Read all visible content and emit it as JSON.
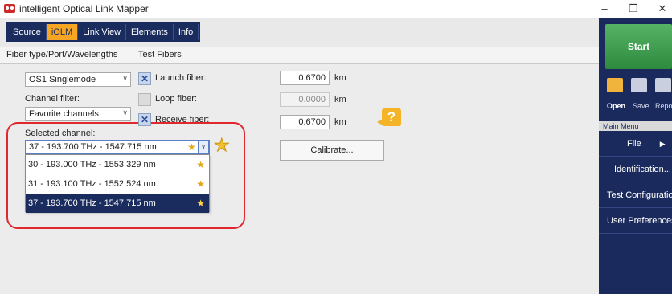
{
  "window": {
    "title": "intelligent Optical Link Mapper",
    "minimize": "–",
    "restore": "❐",
    "close": "✕"
  },
  "tabs": [
    "Source",
    "iOLM",
    "Link View",
    "Elements",
    "Info"
  ],
  "subtabs": {
    "fiber_type": "Fiber type/Port/Wavelengths",
    "test_fibers": "Test Fibers"
  },
  "fiber": {
    "type_value": "OS1 Singlemode",
    "channel_filter_label": "Channel filter:",
    "channel_filter_value": "Favorite channels",
    "selected_channel_label": "Selected channel:",
    "selected_channel_value": "37 - 193.700 THz - 1547.715 nm"
  },
  "channels": [
    {
      "label": "30 - 193.000 THz - 1553.329 nm",
      "favorite_icon": "star-icon"
    },
    {
      "label": "31 - 193.100 THz - 1552.524 nm",
      "favorite_icon": "star-icon"
    },
    {
      "label": "37 - 193.700 THz - 1547.715 nm",
      "favorite_icon": "star-icon"
    }
  ],
  "test_fibers": {
    "launch": {
      "label": "Launch fiber:",
      "checked": true,
      "value": "0.6700",
      "unit": "km"
    },
    "loop": {
      "label": "Loop fiber:",
      "checked": false,
      "value": "0.0000",
      "unit": "km"
    },
    "receive": {
      "label": "Receive fiber:",
      "checked": true,
      "value": "0.6700",
      "unit": "km"
    },
    "calibrate": "Calibrate..."
  },
  "help_glyph": "?",
  "star_glyph": "★",
  "check_glyph": "✕",
  "sidebar": {
    "start": "Start",
    "tools": [
      "Open",
      "Save",
      "Repo"
    ],
    "menu_header": "Main Menu",
    "menu": [
      "File",
      "Identification...",
      "Test Configuration...",
      "User Preferences..."
    ],
    "file_arrow": "▶"
  },
  "colors": {
    "navy": "#1b2a5c",
    "active_tab": "#f6a623",
    "highlight": "#e0282e",
    "start": "#3f9e4f",
    "star": "#f2c12e"
  }
}
